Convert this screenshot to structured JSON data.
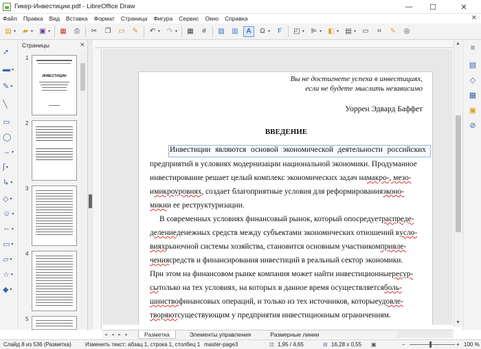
{
  "window": {
    "title": "Гикер-Инвестиции.pdf - LibreOffice Draw",
    "minimize": "—",
    "maximize": "☐",
    "close": "✕"
  },
  "menu": [
    "Файл",
    "Правка",
    "Вид",
    "Вставка",
    "Формат",
    "Страница",
    "Фигура",
    "Сервис",
    "Окно",
    "Справка"
  ],
  "pages_panel": {
    "title": "Страницы",
    "thumb_numbers": [
      "1",
      "2",
      "3",
      "4",
      "5"
    ],
    "thumb1_heading": "ИНВЕСТИЦИИ"
  },
  "document": {
    "epigraph": [
      "Вы не достигнете успеха в инвестициях,",
      "если не будете мыслить независимо"
    ],
    "author": "Уоррен Эдвард Баффет",
    "heading": "ВВЕДЕНИЕ",
    "lines": [
      [
        "Инвестиции",
        "являются",
        "основой",
        "экономической",
        "деятельности",
        "российских"
      ],
      [
        "предприятий в условиях модернизации национальной экономики. Продуманное"
      ],
      [
        "инвестирование решает целый комплекс экономических задач  на ",
        "макро-, мезо-"
      ],
      [
        "и ",
        "микроуровнях",
        ", создает благоприятные условия для реформирования ",
        "эконо-"
      ],
      [
        "мики",
        " и ее реструктуризации."
      ],
      [
        "В современных условиях финансовый рынок, который опосредует ",
        "распреде-"
      ],
      [
        "деление",
        " денежных средств между субъектами экономических отношений в ",
        "усло-"
      ],
      [
        "виях",
        " рыночной системы хозяйства, становится основным участником ",
        "привле-"
      ],
      [
        "чения",
        " средств и финансирования инвестиций в реальный сектор экономики."
      ],
      [
        "При этом на финансовом рынке компания может найти инвестиционные ",
        "ресур-"
      ],
      [
        "сы",
        " только на тех условиях, на которых в данное время осуществляется ",
        "боль-"
      ],
      [
        "шинство",
        " финансовых операций, и только из тех источников, которые ",
        "удовле-"
      ],
      [
        "творяют",
        " существующим у предприятия инвестиционным ограничениям."
      ]
    ]
  },
  "tabs": [
    "Разметка",
    "Элементы управления",
    "Размерные линии"
  ],
  "status": {
    "slide": "Слайд 8 из 536 (Разметка)",
    "edit": "Изменить текст: абзац 1, строка 1, столбец 1",
    "master": "master-page3",
    "position": "1,95 / 4,65",
    "size": "16,28 x 0,55",
    "zoom": "100 %"
  }
}
